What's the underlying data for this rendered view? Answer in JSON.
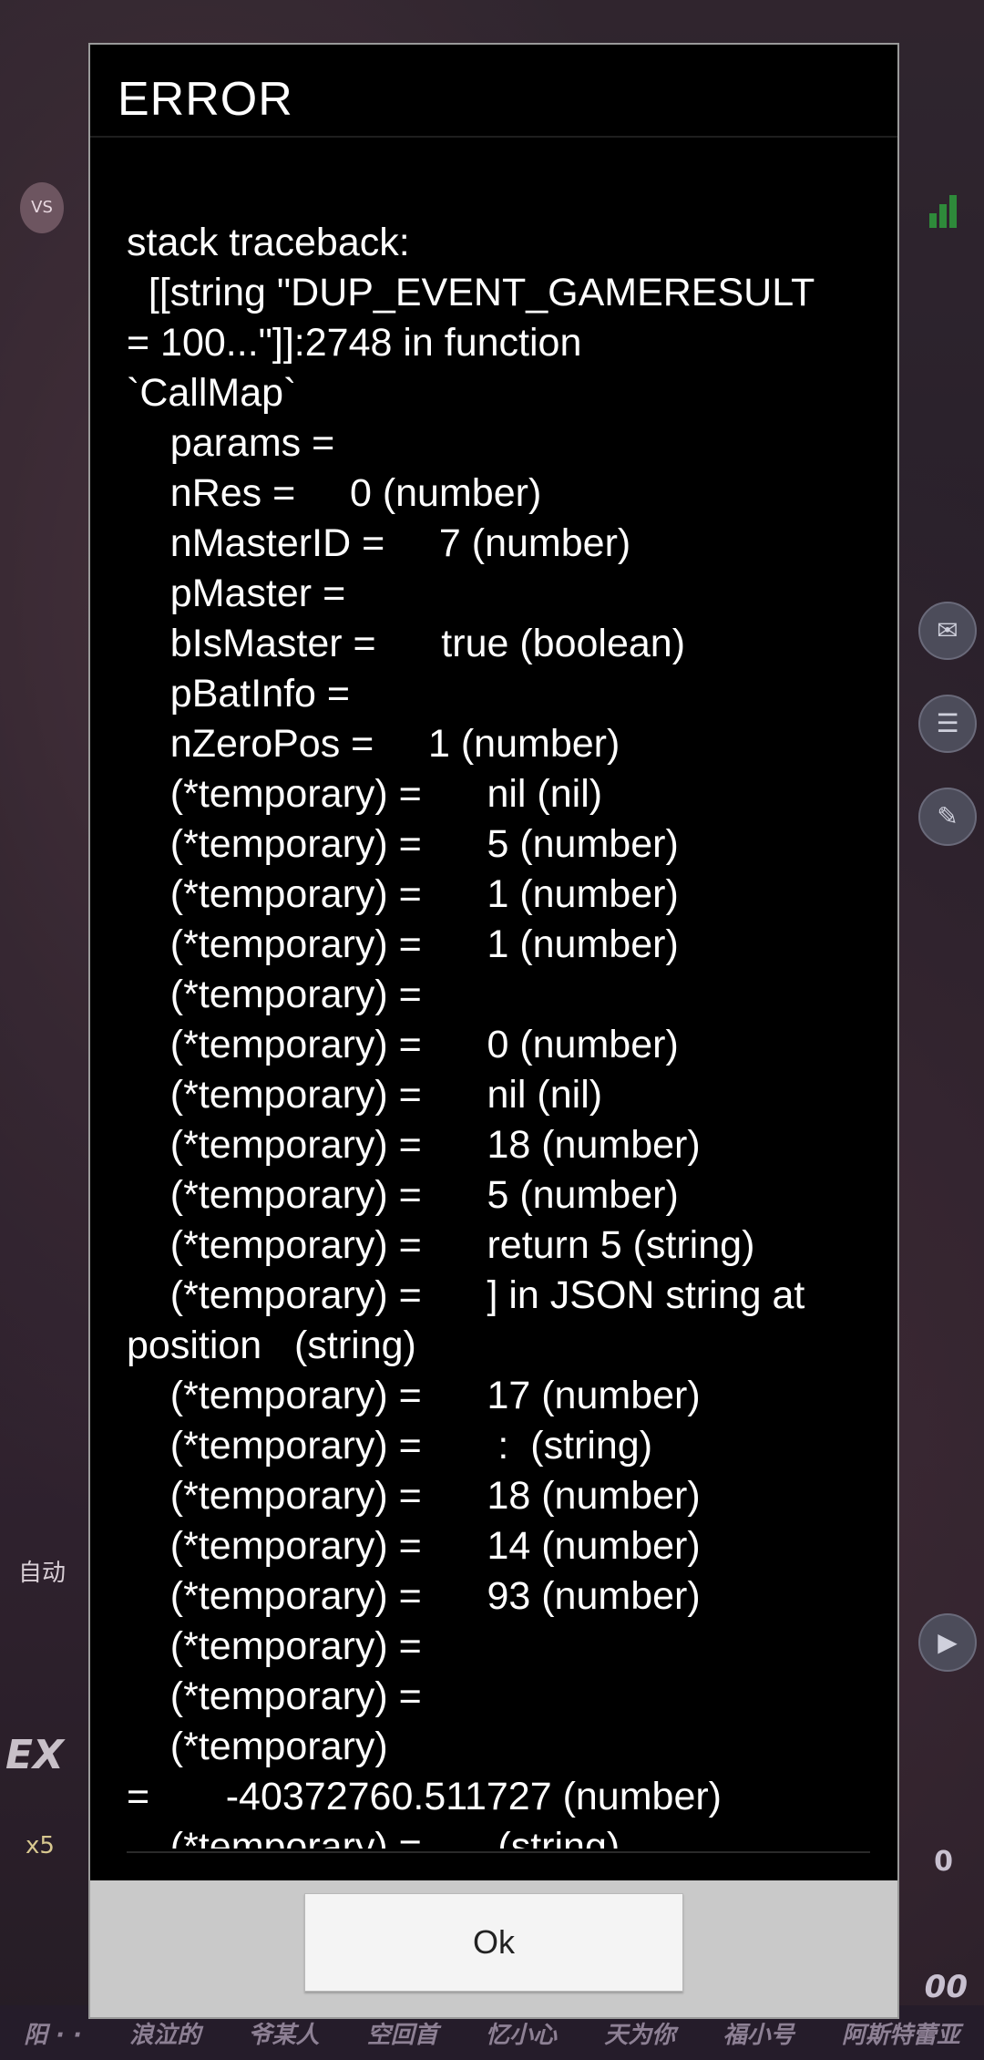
{
  "dialog": {
    "title": "ERROR",
    "ok_label": "Ok",
    "trace_lines": [
      "stack traceback:",
      "  [[string \"DUP_EVENT_GAMERESULT",
      "= 100...\"]]:2748 in function",
      "`CallMap`",
      "    params =",
      "    nRes =     0 (number)",
      "    nMasterID =     7 (number)",
      "    pMaster =",
      "    bIsMaster =      true (boolean)",
      "    pBatInfo =",
      "    nZeroPos =     1 (number)",
      "    (*temporary) =      nil (nil)",
      "    (*temporary) =      5 (number)",
      "    (*temporary) =      1 (number)",
      "    (*temporary) =      1 (number)",
      "    (*temporary) =",
      "    (*temporary) =      0 (number)",
      "    (*temporary) =      nil (nil)",
      "    (*temporary) =      18 (number)",
      "    (*temporary) =      5 (number)",
      "    (*temporary) =      return 5 (string)",
      "    (*temporary) =      ] in JSON string at",
      "position   (string)",
      "    (*temporary) =      17 (number)",
      "    (*temporary) =       :  (string)",
      "    (*temporary) =      18 (number)",
      "    (*temporary) =      14 (number)",
      "    (*temporary) =      93 (number)",
      "    (*temporary) =",
      "    (*temporary) =",
      "    (*temporary)",
      "=       -40372760.511727 (number)",
      "    (*temporary) =       (string)"
    ]
  },
  "background": {
    "vs_label": "VS",
    "auto_label": "自动",
    "ex_label": "EX",
    "coin_label": "x5",
    "right_zero": "0",
    "right_score": "00",
    "player_names": [
      "阳 · ·",
      "浪泣的",
      "爷某人",
      "空回首",
      "忆小心",
      "天为你",
      "福小号",
      "阿斯特蕾亚"
    ]
  }
}
